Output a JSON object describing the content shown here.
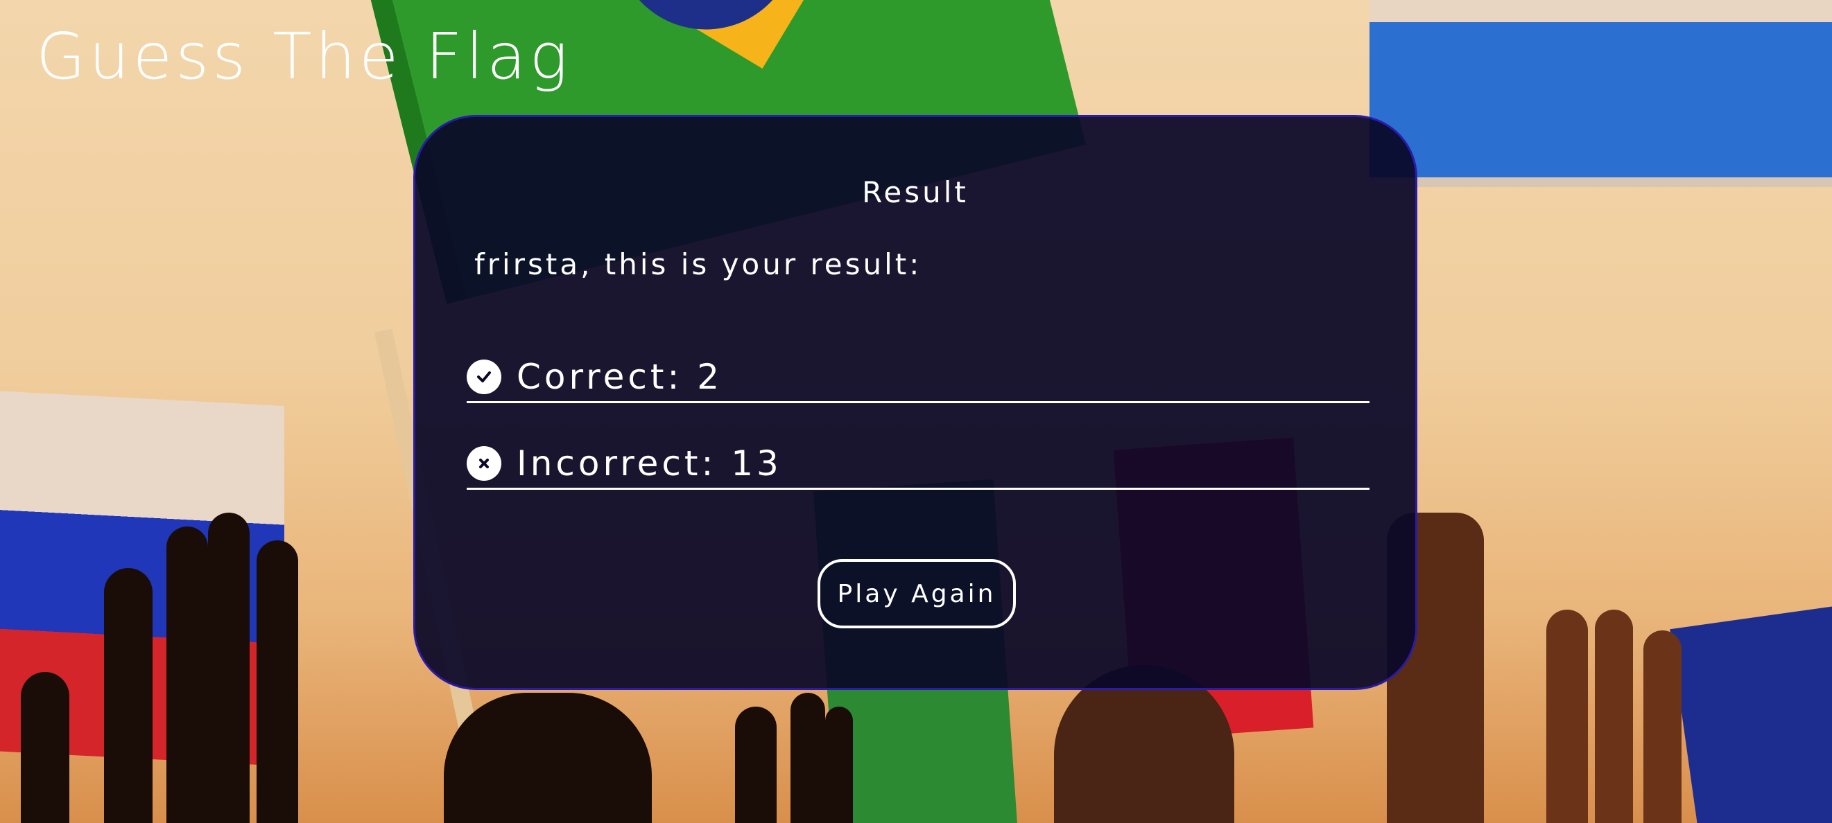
{
  "app": {
    "title": "Guess The Flag"
  },
  "result": {
    "heading": "Result",
    "intro": "frirsta, this is your result:",
    "correct_label": "Correct: 2",
    "incorrect_label": "Incorrect: 13",
    "correct_count": 2,
    "incorrect_count": 13,
    "play_again_label": "Play Again"
  },
  "icons": {
    "correct": "checkmark-circle-icon",
    "incorrect": "x-circle-icon"
  },
  "colors": {
    "card_background": "#0a0828",
    "card_border": "#2a1ba8",
    "text": "#ffffff"
  }
}
